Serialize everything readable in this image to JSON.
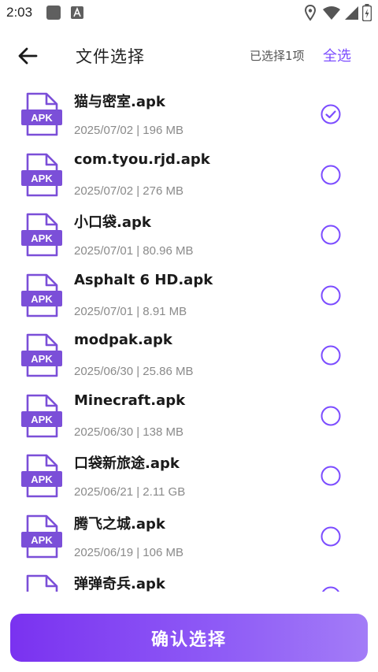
{
  "status_bar": {
    "time": "2:03",
    "icons": [
      "square-notification-icon",
      "a-notification-icon",
      "location-icon",
      "wifi-icon",
      "signal-icon",
      "battery-charging-icon"
    ]
  },
  "header": {
    "back_icon": "arrow-left-icon",
    "title": "文件选择",
    "selected_count": "已选择1项",
    "select_all": "全选"
  },
  "colors": {
    "accent": "#7c4dff",
    "icon_purple": "#7b4fd8",
    "button_gradient_start": "#7a32f0",
    "button_gradient_end": "#a37cf7"
  },
  "apk_label": "APK",
  "files": [
    {
      "name": "猫与密室.apk",
      "meta": "2025/07/02 | 196 MB",
      "selected": true
    },
    {
      "name": "com.tyou.rjd.apk",
      "meta": "2025/07/02 | 276 MB",
      "selected": false
    },
    {
      "name": "小口袋.apk",
      "meta": "2025/07/01 | 80.96 MB",
      "selected": false
    },
    {
      "name": "Asphalt 6 HD.apk",
      "meta": "2025/07/01 | 8.91 MB",
      "selected": false
    },
    {
      "name": "modpak.apk",
      "meta": "2025/06/30 | 25.86 MB",
      "selected": false
    },
    {
      "name": "Minecraft.apk",
      "meta": "2025/06/30 | 138 MB",
      "selected": false
    },
    {
      "name": "口袋新旅途.apk",
      "meta": "2025/06/21 | 2.11 GB",
      "selected": false
    },
    {
      "name": "腾飞之城.apk",
      "meta": "2025/06/19 | 106 MB",
      "selected": false
    },
    {
      "name": "弹弹奇兵.apk",
      "meta": "",
      "selected": false
    }
  ],
  "confirm_button": "确认选择"
}
